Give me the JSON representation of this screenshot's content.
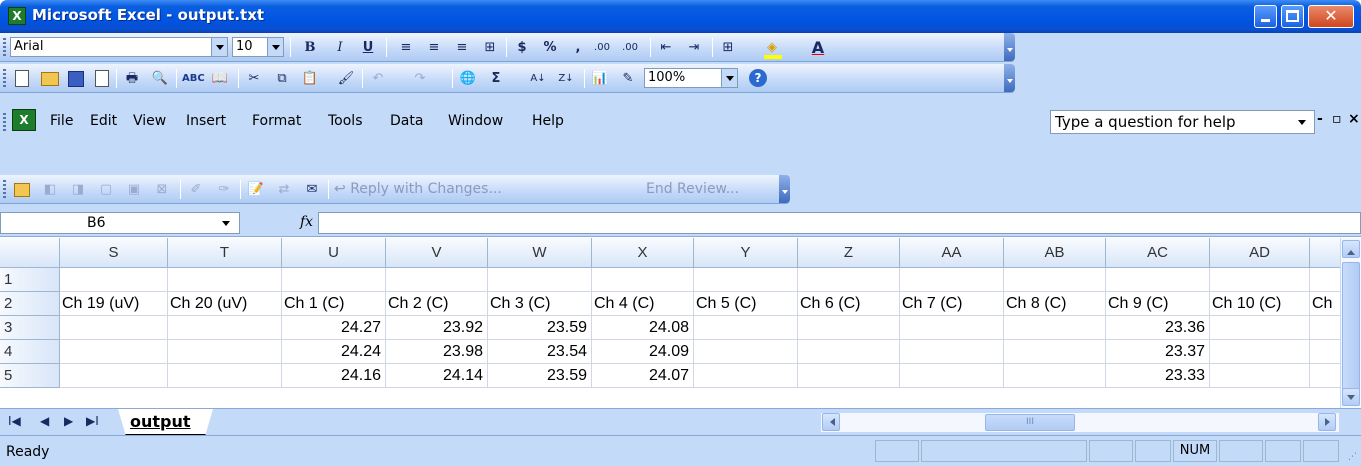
{
  "window": {
    "title": "Microsoft Excel - output.txt",
    "app_icon": "excel-icon"
  },
  "formatting_toolbar": {
    "font_name": "Arial",
    "font_size": "10",
    "buttons": [
      "B",
      "I",
      "U",
      "≡",
      "≡",
      "≡",
      "⊞",
      "$",
      "%",
      ",",
      ".00",
      ".00",
      "⇤",
      "⇥",
      "⊞",
      "◈",
      "A"
    ]
  },
  "standard_toolbar": {
    "zoom": "100%"
  },
  "menu": {
    "items": [
      "File",
      "Edit",
      "View",
      "Insert",
      "Format",
      "Tools",
      "Data",
      "Window",
      "Help"
    ],
    "help_placeholder": "Type a question for help",
    "doc_controls": [
      "-",
      "▫",
      "×"
    ]
  },
  "reviewing_toolbar": {
    "reply_label": "Reply with Changes...",
    "end_review_label": "End Review..."
  },
  "formula_bar": {
    "name_box": "B6",
    "fx_label": "fx",
    "formula": ""
  },
  "grid": {
    "columns": [
      "S",
      "T",
      "U",
      "V",
      "W",
      "X",
      "Y",
      "Z",
      "AA",
      "AB",
      "AC",
      "AD"
    ],
    "rows": [
      {
        "row": "1",
        "cells": [
          "",
          "",
          "",
          "",
          "",
          "",
          "",
          "",
          "",
          "",
          "",
          ""
        ]
      },
      {
        "row": "2",
        "cells": [
          "Ch 19 (uV)",
          "Ch 20 (uV)",
          "Ch 1 (C)",
          "Ch 2 (C)",
          "Ch 3 (C)",
          "Ch 4 (C)",
          "Ch 5 (C)",
          "Ch 6 (C)",
          "Ch 7 (C)",
          "Ch 8 (C)",
          "Ch 9 (C)",
          "Ch 10 (C)",
          "Ch"
        ]
      },
      {
        "row": "3",
        "cells": [
          "",
          "",
          "24.27",
          "23.92",
          "23.59",
          "24.08",
          "",
          "",
          "",
          "",
          "23.36",
          ""
        ]
      },
      {
        "row": "4",
        "cells": [
          "",
          "",
          "24.24",
          "23.98",
          "23.54",
          "24.09",
          "",
          "",
          "",
          "",
          "23.37",
          ""
        ]
      },
      {
        "row": "5",
        "cells": [
          "",
          "",
          "24.16",
          "24.14",
          "23.59",
          "24.07",
          "",
          "",
          "",
          "",
          "23.33",
          ""
        ]
      }
    ]
  },
  "sheet_tabs": {
    "nav": [
      "I◀",
      "◀",
      "▶",
      "▶I"
    ],
    "active": "output"
  },
  "status": {
    "text": "Ready",
    "num_lock": "NUM"
  },
  "colors": {
    "title_bar": "#0054e3",
    "toolbar_bg": "#c3daf9",
    "grid_line": "#d0d7e5"
  }
}
